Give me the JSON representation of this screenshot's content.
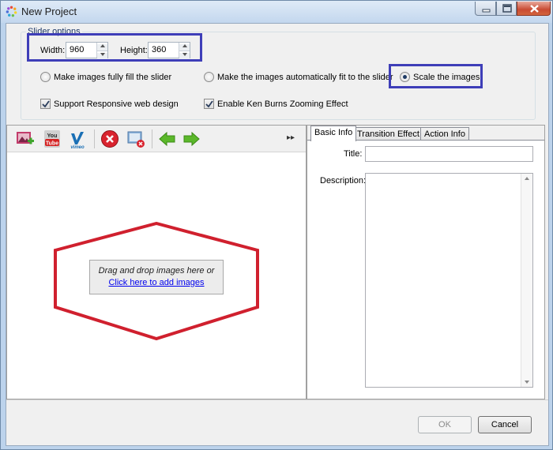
{
  "window": {
    "title": "New Project",
    "app_icon": "colorful-ring-icon"
  },
  "slider_options": {
    "group_label": "Slider options",
    "width_label": "Width:",
    "width_value": "960",
    "height_label": "Height:",
    "height_value": "360",
    "fit_options": [
      {
        "label": "Make images fully fill the slider",
        "selected": false
      },
      {
        "label": "Make the images automatically fit to the slider",
        "selected": false
      },
      {
        "label": "Scale the images",
        "selected": true
      }
    ],
    "responsive_label": "Support Responsive web design",
    "responsive_checked": true,
    "ken_burns_label": "Enable Ken Burns Zooming Effect",
    "ken_burns_checked": true
  },
  "toolbar": {
    "buttons": [
      "add-image-icon",
      "youtube-icon",
      "vimeo-icon",
      "delete-icon",
      "remove-media-icon",
      "arrow-left-icon",
      "arrow-right-icon"
    ],
    "youtube_text": [
      "You",
      "Tube"
    ],
    "vimeo_text": "vimeo",
    "overflow": "▸▸"
  },
  "dropzone": {
    "text": "Drag and drop images here or",
    "link": "Click here to add images"
  },
  "tabs": [
    {
      "label": "Basic Info",
      "active": true
    },
    {
      "label": "Transition Effect",
      "active": false
    },
    {
      "label": "Action Info",
      "active": false
    }
  ],
  "basic_info": {
    "title_label": "Title:",
    "title_value": "",
    "description_label": "Description:",
    "description_value": ""
  },
  "footer": {
    "ok_label": "OK",
    "cancel_label": "Cancel"
  },
  "colors": {
    "highlight_blue": "#3e3eb8",
    "annotation_red": "#d0202e",
    "arrow_green": "#5bb82a",
    "delete_red": "#d9232e"
  }
}
